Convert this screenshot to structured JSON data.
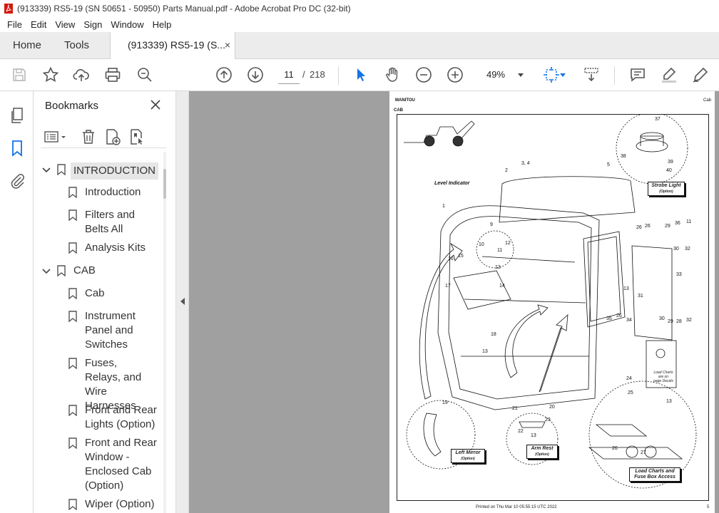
{
  "window": {
    "title": "(913339) RS5-19 (SN 50651 - 50950) Parts Manual.pdf - Adobe Acrobat Pro DC (32-bit)"
  },
  "menu": [
    "File",
    "Edit",
    "View",
    "Sign",
    "Window",
    "Help"
  ],
  "tabs": {
    "home": "Home",
    "tools": "Tools",
    "document": "(913339) RS5-19 (S...",
    "close_glyph": "×"
  },
  "toolbar": {
    "current_page": "11",
    "page_separator": "/",
    "total_pages": "218",
    "zoom": "49%"
  },
  "bookmarks": {
    "title": "Bookmarks",
    "items": [
      {
        "label": "INTRODUCTION",
        "level": 0,
        "expanded": true,
        "selected": true
      },
      {
        "label": "Introduction",
        "level": 1
      },
      {
        "label": "Filters and Belts All",
        "level": 1
      },
      {
        "label": "Analysis Kits",
        "level": 1
      },
      {
        "label": "CAB",
        "level": 0,
        "expanded": true
      },
      {
        "label": "Cab",
        "level": 1
      },
      {
        "label": "Instrument Panel and Switches",
        "level": 1
      },
      {
        "label": "Fuses, Relays, and Wire Harnesses",
        "level": 1
      },
      {
        "label": "Front and Rear Lights (Option)",
        "level": 1
      },
      {
        "label": "Front and Rear Window - Enclosed Cab (Option)",
        "level": 1
      },
      {
        "label": "Wiper (Option)",
        "level": 1
      }
    ]
  },
  "pdf_page": {
    "brand": "MANITOU",
    "section": "CAB",
    "section_right": "Cab",
    "page_number": "5",
    "printed": "Printed on  Thu Mar 10 05:55:15 UTC 2022",
    "labels": {
      "level_indicator": "Level Indicator",
      "strobe_light": "Strobe Light",
      "strobe_option": "(Option)",
      "left_mirror": "Left Mirror",
      "left_mirror_option": "(Option)",
      "arm_rest": "Arm Rest",
      "arm_rest_option": "(Option)",
      "load_charts_1": "Load Charts and",
      "load_charts_2": "Fuse Box Access",
      "decal_1": "Load Charts",
      "decal_2": "are on",
      "decal_3": "page Decals"
    },
    "part_numbers": [
      "1",
      "2",
      "3, 4",
      "5",
      "9",
      "10",
      "11",
      "12",
      "13",
      "14",
      "15",
      "16",
      "17",
      "18",
      "13",
      "19",
      "20",
      "21",
      "22",
      "23",
      "13",
      "24",
      "25",
      "26",
      "27",
      "13",
      "26",
      "26",
      "29",
      "36",
      "11",
      "30",
      "32",
      "33",
      "31",
      "13",
      "35",
      "26",
      "34",
      "30",
      "29",
      "28",
      "32",
      "37",
      "38",
      "39",
      "40"
    ]
  }
}
